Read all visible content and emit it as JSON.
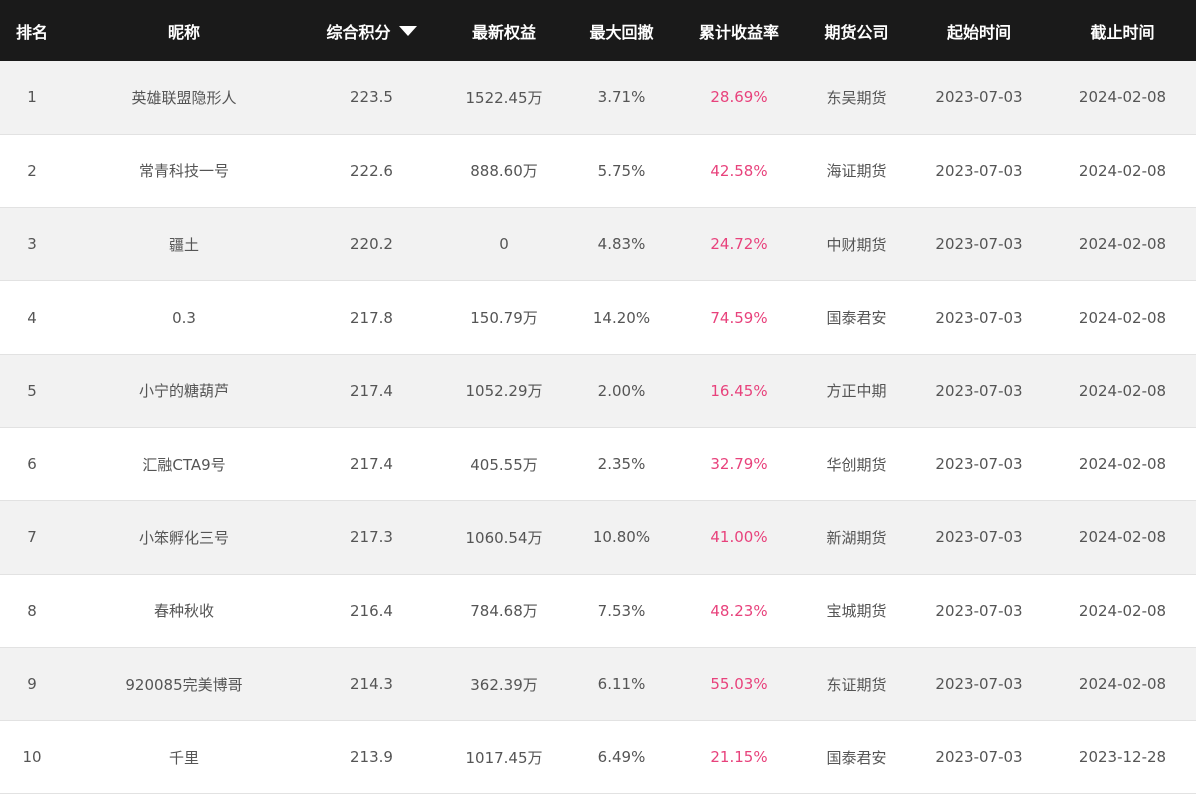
{
  "header": {
    "rank": "排名",
    "nickname": "昵称",
    "score": "综合积分",
    "equity": "最新权益",
    "max_drawdown": "最大回撤",
    "cum_return": "累计收益率",
    "broker": "期货公司",
    "start": "起始时间",
    "end": "截止时间"
  },
  "accent_color": "#e8427c",
  "rows": [
    {
      "rank": "1",
      "nickname": "英雄联盟隐形人",
      "score": "223.5",
      "equity": "1522.45万",
      "max_drawdown": "3.71%",
      "cum_return": "28.69%",
      "broker": "东吴期货",
      "start": "2023-07-03",
      "end": "2024-02-08"
    },
    {
      "rank": "2",
      "nickname": "常青科技一号",
      "score": "222.6",
      "equity": "888.60万",
      "max_drawdown": "5.75%",
      "cum_return": "42.58%",
      "broker": "海证期货",
      "start": "2023-07-03",
      "end": "2024-02-08"
    },
    {
      "rank": "3",
      "nickname": "疆土",
      "score": "220.2",
      "equity": "0",
      "max_drawdown": "4.83%",
      "cum_return": "24.72%",
      "broker": "中财期货",
      "start": "2023-07-03",
      "end": "2024-02-08"
    },
    {
      "rank": "4",
      "nickname": "0.3",
      "score": "217.8",
      "equity": "150.79万",
      "max_drawdown": "14.20%",
      "cum_return": "74.59%",
      "broker": "国泰君安",
      "start": "2023-07-03",
      "end": "2024-02-08"
    },
    {
      "rank": "5",
      "nickname": "小宁的糖葫芦",
      "score": "217.4",
      "equity": "1052.29万",
      "max_drawdown": "2.00%",
      "cum_return": "16.45%",
      "broker": "方正中期",
      "start": "2023-07-03",
      "end": "2024-02-08"
    },
    {
      "rank": "6",
      "nickname": "汇融CTA9号",
      "score": "217.4",
      "equity": "405.55万",
      "max_drawdown": "2.35%",
      "cum_return": "32.79%",
      "broker": "华创期货",
      "start": "2023-07-03",
      "end": "2024-02-08"
    },
    {
      "rank": "7",
      "nickname": "小笨孵化三号",
      "score": "217.3",
      "equity": "1060.54万",
      "max_drawdown": "10.80%",
      "cum_return": "41.00%",
      "broker": "新湖期货",
      "start": "2023-07-03",
      "end": "2024-02-08"
    },
    {
      "rank": "8",
      "nickname": "春种秋收",
      "score": "216.4",
      "equity": "784.68万",
      "max_drawdown": "7.53%",
      "cum_return": "48.23%",
      "broker": "宝城期货",
      "start": "2023-07-03",
      "end": "2024-02-08"
    },
    {
      "rank": "9",
      "nickname": "920085完美博哥",
      "score": "214.3",
      "equity": "362.39万",
      "max_drawdown": "6.11%",
      "cum_return": "55.03%",
      "broker": "东证期货",
      "start": "2023-07-03",
      "end": "2024-02-08"
    },
    {
      "rank": "10",
      "nickname": "千里",
      "score": "213.9",
      "equity": "1017.45万",
      "max_drawdown": "6.49%",
      "cum_return": "21.15%",
      "broker": "国泰君安",
      "start": "2023-07-03",
      "end": "2023-12-28"
    }
  ]
}
